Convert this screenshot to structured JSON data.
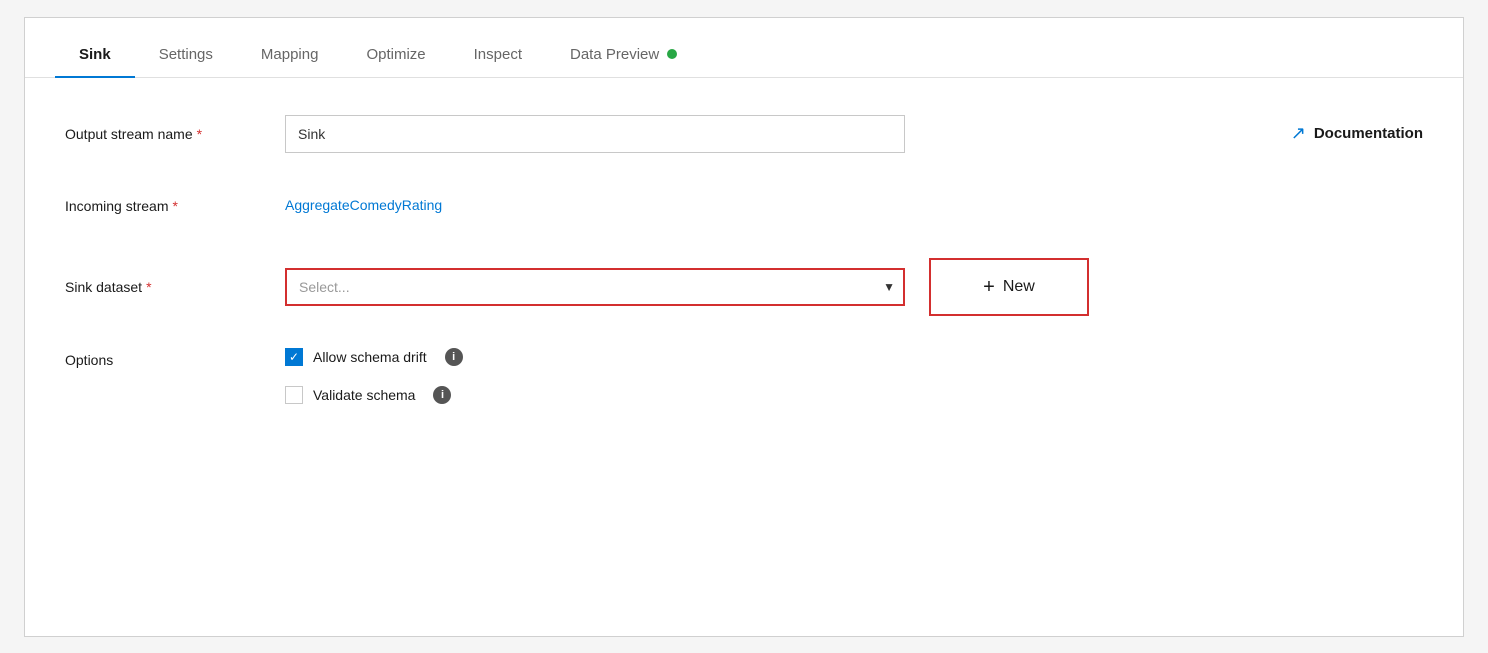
{
  "tabs": [
    {
      "id": "sink",
      "label": "Sink",
      "active": true
    },
    {
      "id": "settings",
      "label": "Settings",
      "active": false
    },
    {
      "id": "mapping",
      "label": "Mapping",
      "active": false
    },
    {
      "id": "optimize",
      "label": "Optimize",
      "active": false
    },
    {
      "id": "inspect",
      "label": "Inspect",
      "active": false
    },
    {
      "id": "data-preview",
      "label": "Data Preview",
      "active": false
    }
  ],
  "fields": {
    "output_stream_name": {
      "label": "Output stream name",
      "required": true,
      "value": "Sink",
      "placeholder": "Sink"
    },
    "incoming_stream": {
      "label": "Incoming stream",
      "required": true,
      "value": "AggregateComedyRating"
    },
    "sink_dataset": {
      "label": "Sink dataset",
      "required": true,
      "placeholder": "Select..."
    },
    "options": {
      "label": "Options",
      "checkboxes": [
        {
          "id": "allow-schema-drift",
          "label": "Allow schema drift",
          "checked": true
        },
        {
          "id": "validate-schema",
          "label": "Validate schema",
          "checked": false
        }
      ]
    }
  },
  "buttons": {
    "new": {
      "label": "New",
      "plus": "+"
    },
    "documentation": {
      "label": "Documentation"
    }
  },
  "colors": {
    "active_tab_underline": "#0078d4",
    "link": "#0078d4",
    "required_star": "#d32f2f",
    "new_button_border": "#d32f2f",
    "select_border": "#d32f2f",
    "dot_green": "#28a745",
    "checkbox_checked": "#0078d4"
  }
}
